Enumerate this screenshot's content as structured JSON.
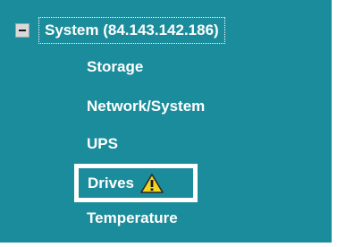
{
  "tree": {
    "root": {
      "label": "System (84.143.142.186)",
      "toggle_icon": "collapse-minus-icon"
    },
    "items": [
      {
        "label": "Storage"
      },
      {
        "label": "Network/System"
      },
      {
        "label": "UPS"
      },
      {
        "label": "Drives",
        "status_icon": "warning-icon",
        "highlighted": true
      },
      {
        "label": "Temperature"
      }
    ]
  },
  "colors": {
    "panel_background": "#1b8c9b",
    "text": "#ffffff",
    "warning": "#f2d51e"
  }
}
